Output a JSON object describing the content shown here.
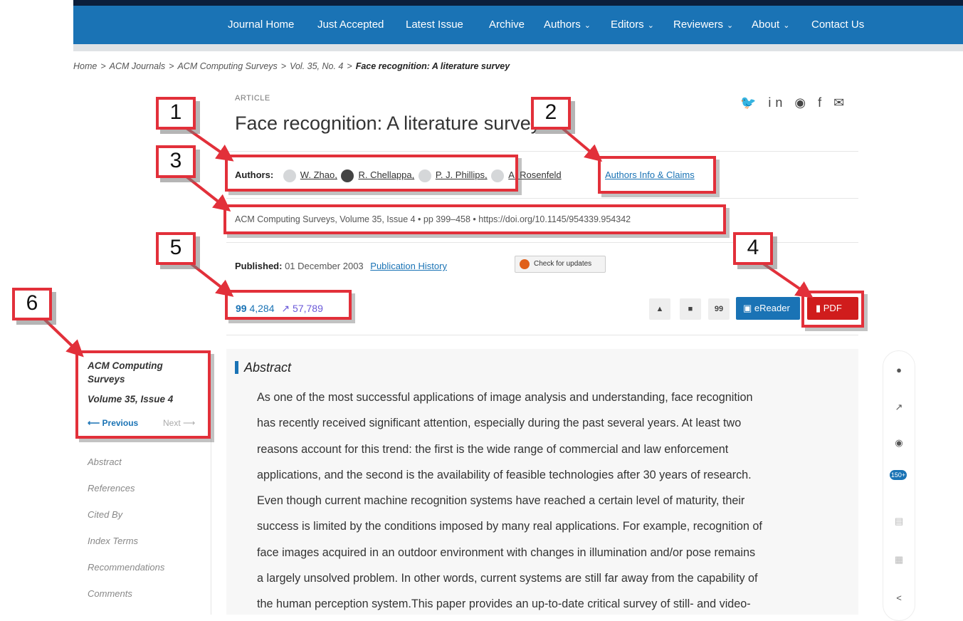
{
  "nav": {
    "items": [
      {
        "label": "Journal Home",
        "dropdown": false
      },
      {
        "label": "Just Accepted",
        "dropdown": false
      },
      {
        "label": "Latest Issue",
        "dropdown": false
      },
      {
        "label": "Archive",
        "dropdown": false
      },
      {
        "label": "Authors",
        "dropdown": true
      },
      {
        "label": "Editors",
        "dropdown": true
      },
      {
        "label": "Reviewers",
        "dropdown": true
      },
      {
        "label": "About",
        "dropdown": true
      },
      {
        "label": "Contact Us",
        "dropdown": false
      }
    ],
    "chevron": "⌄"
  },
  "breadcrumb": {
    "items": [
      "Home",
      "ACM Journals",
      "ACM Computing Surveys",
      "Vol. 35, No. 4"
    ],
    "current": "Face recognition: A literature survey",
    "separator": ">"
  },
  "article": {
    "type_label": "ARTICLE",
    "title": "Face recognition: A literature survey",
    "authors_label": "Authors:",
    "authors": [
      "W. Zhao,",
      "R. Chellappa,",
      "P. J. Phillips,",
      "A. Rosenfeld"
    ],
    "authors_info_link": "Authors Info & Claims",
    "citation": "ACM Computing Surveys, Volume 35, Issue 4 • pp 399–458 • https://doi.org/10.1145/954339.954342",
    "published_label": "Published:",
    "published_date": "01 December 2003",
    "publication_history_link": "Publication History",
    "check_updates_label": "Check for updates",
    "citations_count": "4,284",
    "downloads_count": "57,789",
    "ereader_label": "eReader",
    "pdf_label": "PDF",
    "quote_glyph": "99",
    "trend_glyph": "↗"
  },
  "social_icons": [
    "twitter-icon",
    "linkedin-icon",
    "reddit-icon",
    "facebook-icon",
    "email-icon"
  ],
  "social_glyphs": "🐦 in ◉ f ✉",
  "abstract": {
    "heading": "Abstract",
    "lines": [
      "As one of the most successful applications of image analysis and understanding, face recognition",
      "has recently received significant attention, especially during the past several years. At least two",
      "reasons account for this trend: the first is the wide range of commercial and law enforcement",
      "applications, and the second is the availability of feasible technologies after 30 years of research.",
      "Even though current machine recognition systems have reached a certain level of maturity, their",
      "success is limited by the conditions imposed by many real applications. For example, recognition of",
      "face images acquired in an outdoor environment with changes in illumination and/or pose remains",
      "a largely unsolved problem. In other words, current systems are still far away from the capability of",
      "the human perception system.This paper provides an up-to-date critical survey of still- and video-"
    ]
  },
  "sidebar": {
    "journal": "ACM Computing Surveys",
    "volume": "Volume 35, Issue 4",
    "previous": "⟵ Previous",
    "next": "Next ⟶",
    "nav_items": [
      "Abstract",
      "References",
      "Cited By",
      "Index Terms",
      "Recommendations",
      "Comments"
    ]
  },
  "rail": {
    "badge": "150+"
  },
  "markers": [
    "1",
    "2",
    "3",
    "4",
    "5",
    "6"
  ],
  "colors": {
    "brand_blue": "#1a73b5",
    "pdf_red": "#d01c1c",
    "annotation_red": "#e2303a",
    "downloads_purple": "#6b5ad9"
  }
}
